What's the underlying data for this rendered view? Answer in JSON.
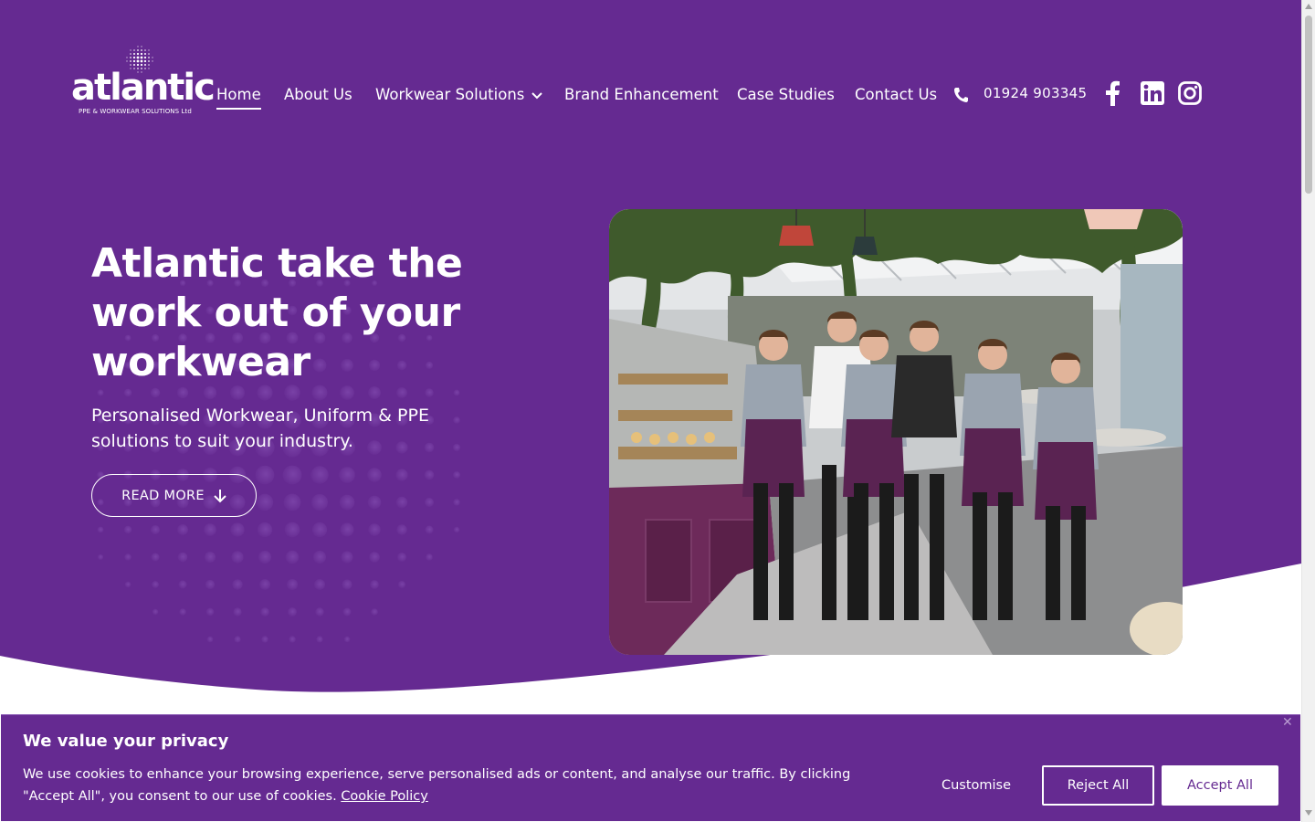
{
  "brand": {
    "name": "atlantic",
    "tagline": "PPE & WORKWEAR SOLUTIONS Ltd",
    "logo_icon": "globe-dots-icon",
    "primary_color": "#652a91",
    "accent_color": "#ffffff"
  },
  "nav": {
    "items": [
      {
        "label": "Home",
        "active": true
      },
      {
        "label": "About Us"
      },
      {
        "label": "Workwear Solutions",
        "has_dropdown": true
      },
      {
        "label": "Brand Enhancement"
      },
      {
        "label": "Case Studies"
      },
      {
        "label": "Contact Us"
      }
    ],
    "phone": "01924 903345",
    "phone_icon": "phone-icon",
    "socials": [
      "facebook-icon",
      "linkedin-icon",
      "instagram-icon"
    ]
  },
  "hero": {
    "title": "Atlantic take the work out of your workwear",
    "subtitle": "Personalised Workwear, Uniform & PPE solutions to suit your industry.",
    "cta_label": "READ MORE",
    "cta_icon": "arrow-down-icon",
    "photo_icon": "team-photo-image"
  },
  "cookie": {
    "title": "We value your privacy",
    "text": "We use cookies to enhance your browsing experience, serve personalised ads or content, and analyse our traffic. By clicking \"Accept All\", you consent to our use of cookies.",
    "link_label": "Cookie Policy",
    "customise_label": "Customise",
    "reject_label": "Reject All",
    "accept_label": "Accept All",
    "close_icon": "close-icon"
  }
}
